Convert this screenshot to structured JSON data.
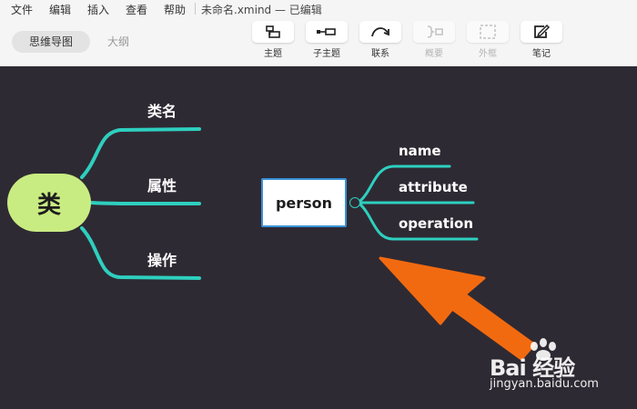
{
  "menubar": {
    "items": [
      "文件",
      "编辑",
      "插入",
      "查看",
      "帮助"
    ],
    "document_title": "未命名.xmind — 已编辑"
  },
  "view_tabs": [
    {
      "label": "思维导图",
      "active": true
    },
    {
      "label": "大纲",
      "active": false
    }
  ],
  "toolbar": {
    "tools": [
      {
        "label": "主题",
        "icon": "topic-icon",
        "enabled": true
      },
      {
        "label": "子主题",
        "icon": "subtopic-icon",
        "enabled": true
      },
      {
        "label": "联系",
        "icon": "relationship-icon",
        "enabled": true
      },
      {
        "label": "概要",
        "icon": "summary-icon",
        "enabled": false
      },
      {
        "label": "外框",
        "icon": "boundary-icon",
        "enabled": false
      },
      {
        "label": "笔记",
        "icon": "notes-icon",
        "enabled": true
      }
    ]
  },
  "mindmap": {
    "central_topic": "类",
    "central_branches": [
      "类名",
      "属性",
      "操作"
    ],
    "floating_topic": "person",
    "floating_branches": [
      "name",
      "attribute",
      "operation"
    ]
  },
  "colors": {
    "canvas_background": "#2e2a33",
    "central_topic_fill": "#c9ec82",
    "branch_line": "#2ecfbf",
    "selection_border": "#3a92d8",
    "arrow": "#f26a10"
  },
  "watermark": {
    "brand": "Bai 经验",
    "url": "jingyan.baidu.com"
  }
}
